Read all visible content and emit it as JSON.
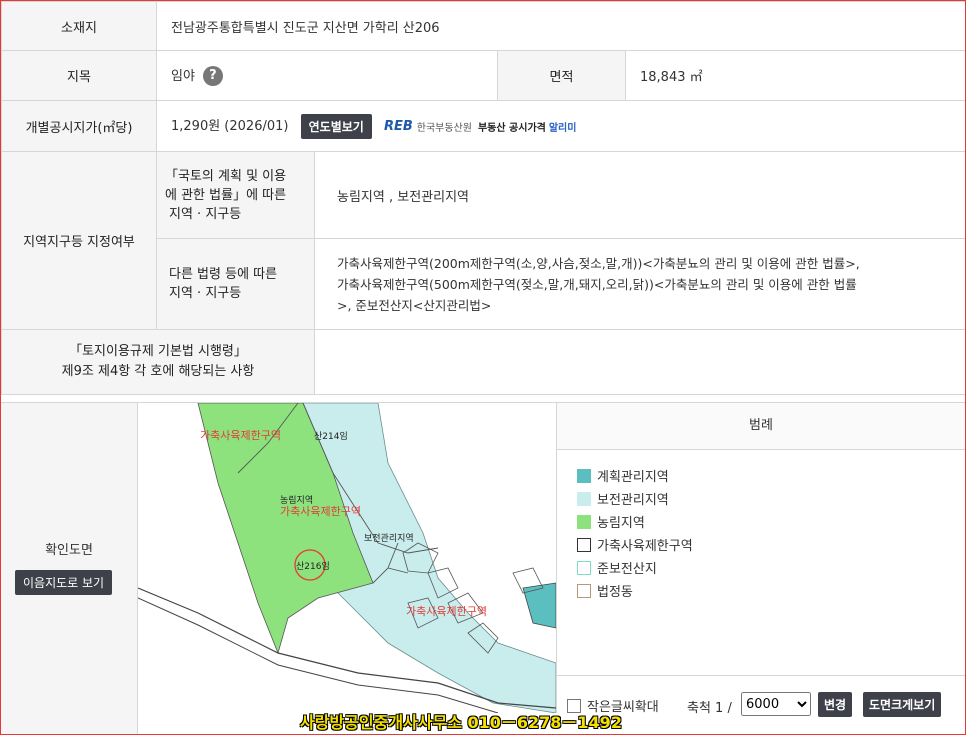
{
  "rows": {
    "address": {
      "label": "소재지",
      "value": "전남광주통합특별시 진도군 지산면 가학리 산206"
    },
    "jimok": {
      "label": "지목",
      "value": "임야",
      "help": "?",
      "area_label": "면적",
      "area_value": "18,843 ㎡"
    },
    "price": {
      "label": "개별공시지가(㎡당)",
      "value": "1,290원 (2026/01)",
      "button": "연도별보기",
      "reb_logo": "REB",
      "reb_org": "한국부동산원",
      "reb_text": "부동산 공시가격",
      "reb_app": "알리미"
    },
    "zoning": {
      "label": "지역지구등 지정여부",
      "sub1_line1": "「국토의 계획 및 이용",
      "sub1_line2": "에 관한 법률」에 따른",
      "sub1_line3": "지역 · 지구등",
      "val1": "농림지역 , 보전관리지역",
      "sub2_line1": "다른 법령 등에 따른",
      "sub2_line2": "지역 · 지구등",
      "val2_line1": "가축사육제한구역(200m제한구역(소,양,사슴,젖소,말,개))<가축분뇨의 관리 및 이용에 관한 법률>,",
      "val2_line2": "가축사육제한구역(500m제한구역(젖소,말,개,돼지,오리,닭))<가축분뇨의 관리 및 이용에 관한 법률",
      "val2_line3": ">, 준보전산지<산지관리법>"
    },
    "rule": {
      "line1": "「토지이용규제 기본법 시행령」",
      "line2": "제9조 제4항 각 호에 해당되는 사항",
      "value": ""
    }
  },
  "map": {
    "label": "확인도면",
    "button": "이음지도로 보기",
    "labels": {
      "zone1": "가축사육제한구역",
      "zone2": "가축사육제한구역",
      "zone3": "가축사육제한구역",
      "parcel1": "산214임",
      "parcel2": "산216임",
      "parcel3": "농림지역",
      "parcel4": "보전관리지역"
    }
  },
  "legend": {
    "title": "범례",
    "items": [
      {
        "label": "계획관리지역",
        "color": "#5bbfc0",
        "border": "#5bbfc0"
      },
      {
        "label": "보전관리지역",
        "color": "#c9ecec",
        "border": "#c9ecec"
      },
      {
        "label": "농림지역",
        "color": "#8ee27e",
        "border": "#8ee27e"
      },
      {
        "label": "가축사육제한구역",
        "color": "#ffffff",
        "border": "#333333"
      },
      {
        "label": "준보전산지",
        "color": "#ffffff",
        "border": "#7fd9c4"
      },
      {
        "label": "법정동",
        "color": "#ffffff",
        "border": "#b39a7a"
      }
    ]
  },
  "controls": {
    "checkbox_label": "작은글씨확대",
    "scale_label": "축척 1 /",
    "scale_value": "6000",
    "change_button": "변경",
    "enlarge_button": "도면크게보기"
  },
  "watermark": "사랑방공인중개사사무소 010－6278－1492"
}
